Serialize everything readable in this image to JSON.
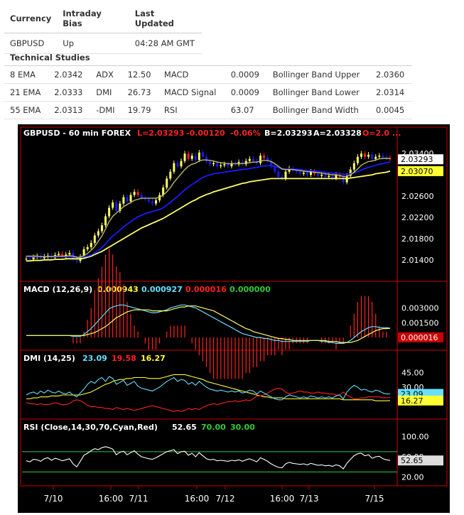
{
  "summary": {
    "headers": [
      "Currency",
      "Intraday Bias",
      "Last Updated"
    ],
    "row": [
      "GBPUSD",
      "Up",
      "04:28 AM GMT"
    ]
  },
  "technical": {
    "title": "Technical Studies",
    "rows": [
      [
        "8 EMA",
        "2.0342",
        "ADX",
        "12.50",
        "MACD",
        "0.0009",
        "Bollinger Band Upper",
        "2.0360"
      ],
      [
        "21 EMA",
        "2.0333",
        "DMI",
        "26.73",
        "MACD Signal",
        "0.0009",
        "Bollinger Band Lower",
        "2.0314"
      ],
      [
        "55 EMA",
        "2.0313",
        "-DMI",
        "19.79",
        "RSI",
        "63.07",
        "Bollinger Band Width",
        "0.0045"
      ]
    ]
  },
  "chart_data": {
    "type": "line",
    "colors": {
      "background": "#000000",
      "frame": "#cc0000",
      "bull": "#ffff66",
      "bear": "#4444ff",
      "ema_fast": "#bdb76b",
      "ema_mid": "#1a1aff",
      "ema_slow": "#ffff66",
      "cyan": "#66e0ff",
      "red": "#ff2222",
      "green": "#33cc33",
      "yellow": "#ffff33",
      "white": "#ffffff"
    },
    "header": {
      "symbol": "GBPUSD - 60 min  FOREX",
      "last": "L=2.03293",
      "change": "-0.00120",
      "change_pct": "-0.06%",
      "bid": "B=2.03293",
      "ask": "A=2.03328",
      "open": "O=2.0 ..."
    },
    "price_panel": {
      "ylim": [
        2.0105,
        2.0355
      ],
      "ticks": [
        "2.01400",
        "2.01800",
        "2.02200",
        "2.02600",
        "2.03400"
      ],
      "tick_values": [
        2.014,
        2.018,
        2.022,
        2.026,
        2.034
      ],
      "markers": [
        {
          "label": "2.03293",
          "value": 2.03293,
          "bg": "#ffffff",
          "fg": "#000000"
        },
        {
          "label": "2.03070",
          "value": 2.0307,
          "bg": "#ffff33",
          "fg": "#000000"
        }
      ],
      "close": [
        2.0142,
        2.0141,
        2.0145,
        2.0147,
        2.0143,
        2.0146,
        2.0148,
        2.0144,
        2.0149,
        2.0151,
        2.0147,
        2.015,
        2.0153,
        2.0142,
        2.0138,
        2.0146,
        2.016,
        2.0164,
        2.0172,
        2.0186,
        2.0194,
        2.0205,
        2.0222,
        2.0238,
        2.0248,
        2.0232,
        2.0246,
        2.0258,
        2.025,
        2.0262,
        2.0268,
        2.0262,
        2.0256,
        2.0254,
        2.025,
        2.0246,
        2.0252,
        2.0262,
        2.0276,
        2.0293,
        2.0306,
        2.0322,
        2.0316,
        2.0326,
        2.034,
        2.033,
        2.0336,
        2.0328,
        2.0342,
        2.0334,
        2.0325,
        2.032,
        2.0322,
        2.0316,
        2.0318,
        2.032,
        2.0316,
        2.0322,
        2.032,
        2.0324,
        2.032,
        2.0326,
        2.033,
        2.0326,
        2.0322,
        2.0336,
        2.0332,
        2.0326,
        2.0316,
        2.0306,
        2.0296,
        2.0293,
        2.0306,
        2.0312,
        2.0308,
        2.0306,
        2.0302,
        2.0304,
        2.03,
        2.0306,
        2.0302,
        2.0298,
        2.03,
        2.0296,
        2.0298,
        2.0294,
        2.03,
        2.0296,
        2.0286,
        2.0298,
        2.031,
        2.0322,
        2.0334,
        2.034,
        2.0334,
        2.0338,
        2.033,
        2.0334,
        2.0336,
        2.0333,
        2.0332,
        2.03293
      ],
      "ema8": [
        2.0147,
        2.0147,
        2.0147,
        2.0147,
        2.0146,
        2.0146,
        2.0146,
        2.0146,
        2.0147,
        2.0147,
        2.0147,
        2.0147,
        2.0148,
        2.0147,
        2.0145,
        2.0145,
        2.0148,
        2.0152,
        2.0158,
        2.0165,
        2.0175,
        2.0185,
        2.0198,
        2.0212,
        2.0222,
        2.0228,
        2.0234,
        2.024,
        2.0244,
        2.0248,
        2.0252,
        2.0254,
        2.0256,
        2.0256,
        2.0256,
        2.0256,
        2.0256,
        2.0258,
        2.0262,
        2.0268,
        2.0276,
        2.0286,
        2.0294,
        2.0302,
        2.031,
        2.0316,
        2.032,
        2.0322,
        2.0326,
        2.0328,
        2.0328,
        2.0327,
        2.0326,
        2.0324,
        2.0323,
        2.0322,
        2.0321,
        2.0321,
        2.0321,
        2.0321,
        2.0321,
        2.0322,
        2.0323,
        2.0324,
        2.0324,
        2.0326,
        2.0327,
        2.0327,
        2.0325,
        2.0321,
        2.0316,
        2.0311,
        2.031,
        2.031,
        2.031,
        2.0309,
        2.0308,
        2.0307,
        2.0306,
        2.0306,
        2.0305,
        2.0304,
        2.0303,
        2.0302,
        2.0301,
        2.03,
        2.03,
        2.0299,
        2.0297,
        2.0297,
        2.03,
        2.0305,
        2.0311,
        2.0318,
        2.0322,
        2.0325,
        2.0326,
        2.0328,
        2.033,
        2.0331,
        2.0331,
        2.0331
      ],
      "ema21": [
        2.0146,
        2.0146,
        2.0146,
        2.0146,
        2.0146,
        2.0146,
        2.0146,
        2.0146,
        2.0146,
        2.0146,
        2.0146,
        2.0146,
        2.0146,
        2.0146,
        2.0145,
        2.0145,
        2.0146,
        2.0147,
        2.0149,
        2.0153,
        2.0158,
        2.0163,
        2.017,
        2.0178,
        2.0185,
        2.019,
        2.0196,
        2.0202,
        2.0207,
        2.0212,
        2.0217,
        2.0221,
        2.0224,
        2.0227,
        2.0229,
        2.0231,
        2.0233,
        2.0235,
        2.0238,
        2.0243,
        2.0248,
        2.0254,
        2.0259,
        2.0266,
        2.0272,
        2.0277,
        2.0282,
        2.0286,
        2.0291,
        2.0295,
        2.0298,
        2.03,
        2.0302,
        2.0303,
        2.0304,
        2.0305,
        2.0306,
        2.0307,
        2.0308,
        2.0309,
        2.031,
        2.0311,
        2.0312,
        2.0313,
        2.0314,
        2.0316,
        2.0317,
        2.0317,
        2.0317,
        2.0316,
        2.0314,
        2.0312,
        2.0311,
        2.0311,
        2.0311,
        2.031,
        2.031,
        2.0309,
        2.0308,
        2.0308,
        2.0307,
        2.0306,
        2.0306,
        2.0305,
        2.0304,
        2.0303,
        2.0303,
        2.0302,
        2.0301,
        2.0301,
        2.0302,
        2.0304,
        2.0306,
        2.0309,
        2.0312,
        2.0314,
        2.0316,
        2.0318,
        2.032,
        2.0321,
        2.0323,
        2.0324
      ],
      "ema55": [
        2.0138,
        2.0138,
        2.0139,
        2.0139,
        2.0139,
        2.014,
        2.014,
        2.014,
        2.0141,
        2.0141,
        2.0141,
        2.0142,
        2.0142,
        2.0142,
        2.0142,
        2.0142,
        2.0143,
        2.0145,
        2.0147,
        2.015,
        2.0153,
        2.0156,
        2.016,
        2.0164,
        2.0168,
        2.0172,
        2.0176,
        2.018,
        2.0184,
        2.0188,
        2.0192,
        2.0196,
        2.02,
        2.0203,
        2.0206,
        2.0209,
        2.0212,
        2.0215,
        2.0218,
        2.0222,
        2.0226,
        2.023,
        2.0234,
        2.0238,
        2.0242,
        2.0246,
        2.025,
        2.0253,
        2.0257,
        2.026,
        2.0263,
        2.0265,
        2.0268,
        2.027,
        2.0272,
        2.0274,
        2.0276,
        2.0278,
        2.028,
        2.0282,
        2.0284,
        2.0285,
        2.0287,
        2.0288,
        2.0289,
        2.029,
        2.0291,
        2.0292,
        2.0293,
        2.0293,
        2.0293,
        2.0293,
        2.0293,
        2.0293,
        2.0293,
        2.0293,
        2.0293,
        2.0293,
        2.0293,
        2.0293,
        2.0293,
        2.0293,
        2.0293,
        2.0293,
        2.0293,
        2.0293,
        2.0293,
        2.0293,
        2.0293,
        2.0293,
        2.0294,
        2.0295,
        2.0296,
        2.0297,
        2.0298,
        2.0299,
        2.03,
        2.0302,
        2.0303,
        2.0304,
        2.0305,
        2.0307
      ]
    },
    "macd_panel": {
      "title": "MACD (12,26,9)",
      "values": [
        "0.000943",
        "0.000927",
        "0.000016",
        "0.000000"
      ],
      "value_colors": [
        "#ffff33",
        "#66e0ff",
        "#ff2222",
        "#33cc33"
      ],
      "ylim": [
        -0.001,
        0.0044
      ],
      "ticks": [
        "0.003000",
        "0.001500"
      ],
      "tick_values": [
        0.003,
        0.0015
      ],
      "marker": {
        "label": "0.000016",
        "value": 1.6e-05,
        "bg": "#cc0000",
        "fg": "#ffffff"
      },
      "macd": [
        0.0002,
        0.0002,
        0.0002,
        0.0002,
        0.0002,
        0.0002,
        0.0002,
        0.0002,
        0.0002,
        0.0002,
        0.0002,
        0.0002,
        0.0002,
        0.0001,
        0.0001,
        0.0001,
        0.0003,
        0.0006,
        0.0009,
        0.0013,
        0.0017,
        0.0021,
        0.0025,
        0.0029,
        0.0031,
        0.0032,
        0.0033,
        0.0033,
        0.0032,
        0.0031,
        0.003,
        0.0029,
        0.0028,
        0.0027,
        0.0026,
        0.0025,
        0.0025,
        0.0026,
        0.0027,
        0.0028,
        0.003,
        0.0031,
        0.0032,
        0.0033,
        0.0033,
        0.0032,
        0.0031,
        0.003,
        0.0028,
        0.0026,
        0.0024,
        0.0022,
        0.002,
        0.0018,
        0.0016,
        0.0014,
        0.0012,
        0.001,
        0.0008,
        0.0006,
        0.0004,
        0.0003,
        0.0002,
        0.0001,
        0.0,
        0.0,
        -0.0001,
        -0.0001,
        -0.0002,
        -0.0003,
        -0.0003,
        -0.0004,
        -0.0004,
        -0.0004,
        -0.0004,
        -0.0004,
        -0.0004,
        -0.0004,
        -0.0004,
        -0.0003,
        -0.0003,
        -0.0003,
        -0.0004,
        -0.0004,
        -0.0005,
        -0.0005,
        -0.0006,
        -0.0006,
        -0.0006,
        -0.0005,
        -0.0003,
        0.0,
        0.0003,
        0.0006,
        0.0008,
        0.001,
        0.0011,
        0.0011,
        0.001,
        0.001,
        0.001,
        0.00094
      ],
      "signal": [
        0.0002,
        0.0002,
        0.0002,
        0.0002,
        0.0002,
        0.0002,
        0.0002,
        0.0002,
        0.0002,
        0.0002,
        0.0002,
        0.0002,
        0.0002,
        0.0002,
        0.0002,
        0.0002,
        0.0002,
        0.0003,
        0.0004,
        0.0005,
        0.0007,
        0.0009,
        0.0011,
        0.0014,
        0.0017,
        0.002,
        0.0022,
        0.0024,
        0.0026,
        0.0027,
        0.0028,
        0.0028,
        0.0028,
        0.0028,
        0.0028,
        0.0027,
        0.0027,
        0.0027,
        0.0027,
        0.0027,
        0.0028,
        0.0029,
        0.003,
        0.0031,
        0.0031,
        0.0032,
        0.0032,
        0.0032,
        0.0031,
        0.003,
        0.0029,
        0.0028,
        0.0027,
        0.0025,
        0.0023,
        0.0021,
        0.0019,
        0.0017,
        0.0015,
        0.0013,
        0.0011,
        0.0009,
        0.0008,
        0.0006,
        0.0005,
        0.0004,
        0.0003,
        0.0002,
        0.0001,
        0.0,
        -0.0001,
        -0.0001,
        -0.0002,
        -0.0002,
        -0.0003,
        -0.0003,
        -0.0003,
        -0.0003,
        -0.0003,
        -0.0003,
        -0.0003,
        -0.0003,
        -0.0003,
        -0.0003,
        -0.0004,
        -0.0004,
        -0.0004,
        -0.0005,
        -0.0005,
        -0.0005,
        -0.0005,
        -0.0004,
        -0.0003,
        -0.0001,
        0.0001,
        0.0003,
        0.0005,
        0.0007,
        0.0008,
        0.0009,
        0.0009,
        0.00093
      ]
    },
    "dmi_panel": {
      "title": "DMI (14,25)",
      "values": [
        "23.09",
        "19.58",
        "16.27"
      ],
      "value_colors": [
        "#66e0ff",
        "#ff2222",
        "#ffff33"
      ],
      "ylim": [
        0,
        55
      ],
      "ticks": [
        "45.00",
        "30.00"
      ],
      "tick_values": [
        45,
        30
      ],
      "markers": [
        {
          "label": "23.09",
          "value": 23.09,
          "bg": "#66e0ff",
          "fg": "#000000"
        },
        {
          "label": "16.27",
          "value": 16.27,
          "bg": "#ffff33",
          "fg": "#000000"
        }
      ],
      "plus_di": [
        22,
        24,
        25,
        23,
        26,
        24,
        27,
        25,
        24,
        26,
        24,
        23,
        25,
        22,
        20,
        24,
        28,
        33,
        36,
        34,
        38,
        40,
        36,
        41,
        39,
        33,
        35,
        37,
        32,
        34,
        36,
        31,
        29,
        28,
        27,
        26,
        28,
        30,
        33,
        36,
        38,
        40,
        36,
        38,
        37,
        33,
        35,
        32,
        36,
        33,
        30,
        28,
        27,
        26,
        27,
        26,
        25,
        26,
        25,
        26,
        24,
        25,
        27,
        26,
        23,
        26,
        24,
        22,
        20,
        18,
        17,
        17,
        20,
        22,
        21,
        20,
        19,
        20,
        19,
        21,
        20,
        19,
        20,
        19,
        20,
        19,
        21,
        22,
        18,
        25,
        29,
        32,
        30,
        27,
        28,
        26,
        25,
        27,
        26,
        24,
        23,
        23.09
      ],
      "minus_di": [
        14,
        13,
        13,
        12,
        13,
        12,
        12,
        13,
        14,
        13,
        12,
        12,
        13,
        16,
        17,
        16,
        14,
        11,
        10,
        10,
        9,
        9,
        8,
        8,
        7,
        9,
        8,
        7,
        8,
        7,
        6,
        7,
        8,
        9,
        10,
        11,
        10,
        9,
        8,
        7,
        6,
        5,
        6,
        5,
        6,
        8,
        7,
        8,
        7,
        9,
        11,
        12,
        13,
        12,
        13,
        14,
        15,
        15,
        16,
        15,
        16,
        17,
        16,
        18,
        21,
        21,
        22,
        24,
        26,
        28,
        29,
        28,
        25,
        23,
        24,
        25,
        26,
        25,
        25,
        24,
        24,
        25,
        24,
        24,
        23,
        23,
        22,
        22,
        25,
        22,
        20,
        18,
        18,
        19,
        19,
        20,
        20,
        20,
        20,
        19,
        19,
        19.58
      ],
      "adx": [
        18,
        18,
        19,
        19,
        20,
        20,
        20,
        21,
        21,
        21,
        22,
        22,
        22,
        22,
        22,
        22,
        23,
        24,
        25,
        27,
        29,
        31,
        33,
        34,
        36,
        37,
        38,
        38,
        39,
        39,
        40,
        40,
        40,
        40,
        39,
        39,
        39,
        39,
        40,
        41,
        42,
        43,
        43,
        43,
        43,
        42,
        41,
        40,
        39,
        38,
        36,
        35,
        34,
        33,
        32,
        31,
        30,
        29,
        28,
        27,
        26,
        25,
        24,
        23,
        22,
        21,
        20,
        20,
        19,
        19,
        19,
        19,
        18,
        18,
        18,
        18,
        18,
        18,
        18,
        18,
        18,
        18,
        18,
        18,
        18,
        18,
        18,
        18,
        17,
        17,
        17,
        17,
        17,
        17,
        17,
        17,
        17,
        16,
        16,
        16,
        16,
        16.27
      ]
    },
    "rsi_panel": {
      "title": "RSI (Close,14,30,70,Cyan,Red)",
      "values": [
        "52.65",
        "70.00",
        "30.00"
      ],
      "value_colors": [
        "#ffffff",
        "#33cc33",
        "#33cc33"
      ],
      "ylim": [
        8,
        112
      ],
      "ticks": [
        "100.00",
        "60.00",
        "20.00"
      ],
      "tick_values": [
        100,
        60,
        20
      ],
      "levels": [
        70,
        30
      ],
      "marker": {
        "label": "52.65",
        "value": 52.65,
        "bg": "#dddddd",
        "fg": "#000000"
      },
      "rsi": [
        52,
        50,
        55,
        54,
        51,
        56,
        58,
        53,
        57,
        55,
        52,
        54,
        56,
        46,
        40,
        51,
        63,
        67,
        72,
        76,
        74,
        78,
        80,
        78,
        75,
        64,
        69,
        71,
        64,
        68,
        72,
        65,
        60,
        58,
        56,
        55,
        58,
        62,
        66,
        70,
        72,
        74,
        66,
        70,
        71,
        63,
        67,
        60,
        68,
        62,
        56,
        54,
        55,
        52,
        53,
        52,
        51,
        53,
        52,
        54,
        51,
        54,
        56,
        53,
        50,
        58,
        55,
        51,
        46,
        42,
        39,
        38,
        46,
        49,
        47,
        46,
        45,
        46,
        44,
        47,
        45,
        43,
        44,
        42,
        43,
        41,
        44,
        42,
        36,
        47,
        55,
        62,
        66,
        67,
        62,
        64,
        57,
        60,
        61,
        56,
        54,
        52.65
      ]
    },
    "x_ticks": [
      "7/10",
      "16:00",
      "7/11",
      "16:00",
      "7/12",
      "16:00",
      "7/13",
      "7/15"
    ]
  }
}
